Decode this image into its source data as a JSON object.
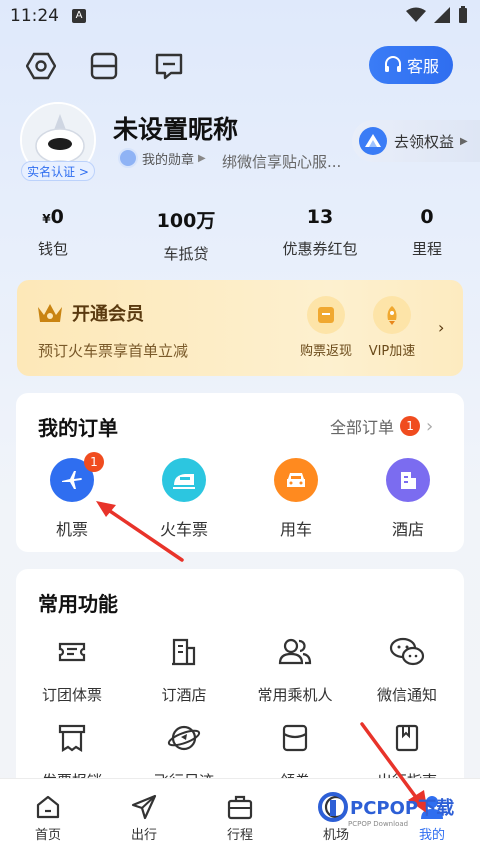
{
  "status_bar": {
    "time": "11:24",
    "a_icon": "A"
  },
  "top_bar": {
    "service_label": "客服"
  },
  "profile": {
    "nickname": "未设置昵称",
    "verify_label": "实名认证 >",
    "medal_label": "我的勋章",
    "wechat_tip": "绑微信享贴心服...",
    "rights_label": "去领权益"
  },
  "stats": [
    {
      "value_prefix": "¥",
      "value": "0",
      "label": "钱包"
    },
    {
      "value_prefix": "",
      "value": "100万",
      "label": "车抵贷"
    },
    {
      "value_prefix": "",
      "value": "13",
      "label": "优惠券红包"
    },
    {
      "value_prefix": "",
      "value": "0",
      "label": "里程"
    }
  ],
  "vip": {
    "title": "开通会员",
    "subtitle": "预订火车票享首单立减",
    "items": [
      {
        "label": "购票返现"
      },
      {
        "label": "VIP加速"
      }
    ]
  },
  "orders": {
    "title": "我的订单",
    "all_label": "全部订单",
    "all_badge": "1",
    "items": [
      {
        "label": "机票",
        "badge": "1",
        "color": "#2f6ef0",
        "icon": "plane-icon"
      },
      {
        "label": "火车票",
        "color": "#2cc6e0",
        "icon": "train-icon"
      },
      {
        "label": "用车",
        "color": "#ff8a1f",
        "icon": "car-icon"
      },
      {
        "label": "酒店",
        "color": "#7b6cf0",
        "icon": "hotel-icon"
      }
    ]
  },
  "functions": {
    "title": "常用功能",
    "items": [
      {
        "label": "订团体票",
        "icon": "ticket-icon"
      },
      {
        "label": "订酒店",
        "icon": "building-icon"
      },
      {
        "label": "常用乘机人",
        "icon": "people-icon"
      },
      {
        "label": "微信通知",
        "icon": "chat-icon"
      },
      {
        "label": "发票报销",
        "icon": "invoice-icon"
      },
      {
        "label": "飞行足迹",
        "icon": "planet-icon"
      },
      {
        "label": "领券",
        "icon": "coupon-icon"
      },
      {
        "label": "出行指南",
        "icon": "guide-icon"
      }
    ]
  },
  "bottom_nav": [
    {
      "label": "首页",
      "icon": "home-icon"
    },
    {
      "label": "出行",
      "icon": "send-icon"
    },
    {
      "label": "行程",
      "icon": "bag-icon"
    },
    {
      "label": "机场",
      "icon": "airport-icon"
    },
    {
      "label": "我的",
      "icon": "user-icon",
      "active": true
    }
  ],
  "watermark": {
    "text": "PCPOP下载",
    "sub": "PCPOP Download"
  }
}
